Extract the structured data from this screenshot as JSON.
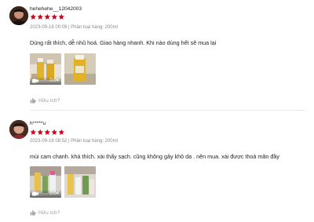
{
  "colors": {
    "star": "#d0011b",
    "meta": "#8a8a8a",
    "text": "#222222",
    "like": "#9a9a9a"
  },
  "reviews": [
    {
      "username": "hehehehe__12042003",
      "rating": 5,
      "meta": "2023-09-18 00:09 | Phân loại hàng: 200ml",
      "content": "Dùng rất thích, dễ nhũ hoá. Giao hàng nhanh. Khi nào dùng hết sẽ mua lại",
      "media": [
        {
          "type": "video",
          "duration": "0:04",
          "icon": "video-camera-icon"
        },
        {
          "type": "image"
        }
      ],
      "like_label": "Hữu ích?",
      "like_icon": "thumbs-up-icon"
    },
    {
      "username": "h*****u",
      "rating": 5,
      "meta": "2023-09-18 08:52 | Phân loại hàng: 200ml",
      "content": "mùi cam chanh. khá thích. xài thấy sạch. cũng không gây khô da . nên mua. xài được thoả mãn đầy",
      "media": [
        {
          "type": "video",
          "duration": "0:04",
          "icon": "video-camera-icon"
        },
        {
          "type": "image"
        }
      ],
      "like_label": "Hữu ích?",
      "like_icon": "thumbs-up-icon"
    }
  ]
}
